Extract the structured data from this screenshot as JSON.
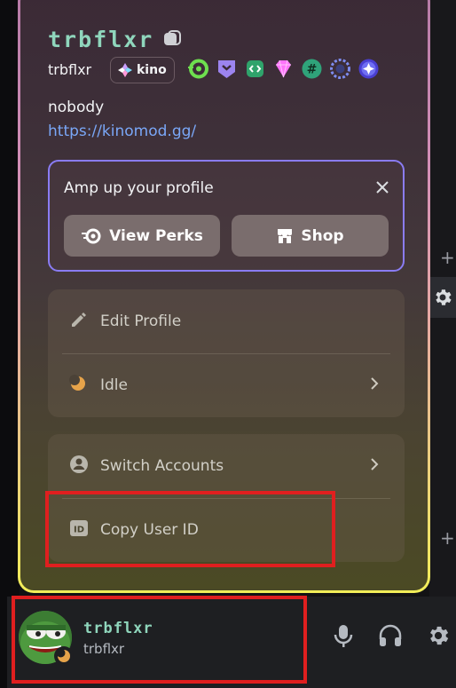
{
  "profile": {
    "display_name": "trbflxr",
    "username": "trbflxr",
    "tag_label": "kino",
    "pronoun": "nobody",
    "link": "https://kinomod.gg/"
  },
  "badges": [
    "nitro-icon",
    "hypesquad-icon",
    "active-developer-icon",
    "server-booster-icon",
    "hashtag-badge-icon",
    "quest-laurel-icon",
    "orb-badge-icon"
  ],
  "amp": {
    "title": "Amp up your profile",
    "view_perks": "View Perks",
    "shop": "Shop"
  },
  "menu": {
    "edit_profile": "Edit Profile",
    "idle": "Idle",
    "switch_accounts": "Switch Accounts",
    "copy_user_id": "Copy User ID"
  },
  "userbar": {
    "display_name": "trbflxr",
    "username": "trbflxr"
  },
  "colors": {
    "accent": "#8a7cf4",
    "name_color": "#8fd6bc",
    "link": "#7aa7f7",
    "highlight": "#e01f1f",
    "idle": "#e6a34a"
  }
}
